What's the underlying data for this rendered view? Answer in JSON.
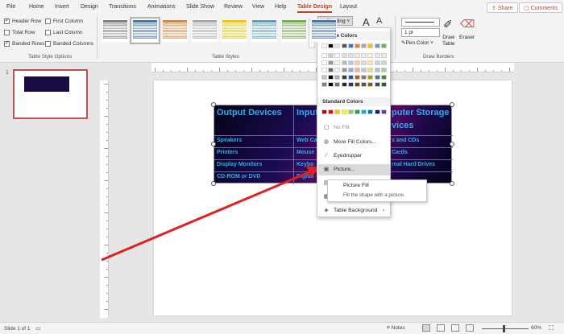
{
  "menu": {
    "tabs": [
      "File",
      "Home",
      "Insert",
      "Design",
      "Transitions",
      "Animations",
      "Slide Show",
      "Review",
      "View",
      "Help",
      "Table Design",
      "Layout"
    ],
    "active_tab": "Table Design",
    "share": "Share",
    "comments": "Comments"
  },
  "ribbon": {
    "options": {
      "header_row": "Header Row",
      "first_column": "First Column",
      "total_row": "Total Row",
      "last_column": "Last Column",
      "banded_rows": "Banded Rows",
      "banded_columns": "Banded Columns",
      "group_label": "Table Style Options"
    },
    "styles_label": "Table Styles",
    "shading_label": "Shading",
    "pen_weight": "1 pt",
    "pen_color": "Pen Color",
    "draw_table": "Draw\nTable",
    "eraser": "Eraser",
    "draw_borders_label": "Draw Borders"
  },
  "thumbnail": {
    "number": "1"
  },
  "table": {
    "headers": [
      "Output Devices",
      "Input",
      "puter Storage",
      "vices"
    ],
    "col1": [
      "Speakers",
      "Printers",
      "Display Monitors",
      "CD-ROM or DVD"
    ],
    "col2": [
      "Web Ca",
      "Mouse",
      "Keybo",
      "Digital"
    ],
    "col3": [
      "s and CDs",
      "Cards",
      "rnal Hard Drives",
      ""
    ]
  },
  "shading_menu": {
    "theme_colors": "Theme Colors",
    "standard_colors": "Standard Colors",
    "no_fill": "No Fill",
    "more_fill": "More Fill Colors...",
    "eyedropper": "Eyedropper",
    "picture": "Picture...",
    "gradient": "Gr",
    "texture": "Te",
    "table_background": "Table Background",
    "theme_top": [
      "#ffffff",
      "#000000",
      "#e7e6e6",
      "#44546a",
      "#4472c4",
      "#ed7d31",
      "#a5a5a5",
      "#ffc000",
      "#5b9bd5",
      "#70ad47"
    ],
    "standard": [
      "#c00000",
      "#ff0000",
      "#ffc000",
      "#ffff00",
      "#92d050",
      "#00b050",
      "#00b0f0",
      "#0070c0",
      "#002060",
      "#7030a0"
    ]
  },
  "tooltip": {
    "title": "Picture Fill",
    "desc": "Fill the shape with a picture."
  },
  "status": {
    "slide": "Slide 1 of 1",
    "notes": "Notes",
    "zoom": "60%"
  }
}
